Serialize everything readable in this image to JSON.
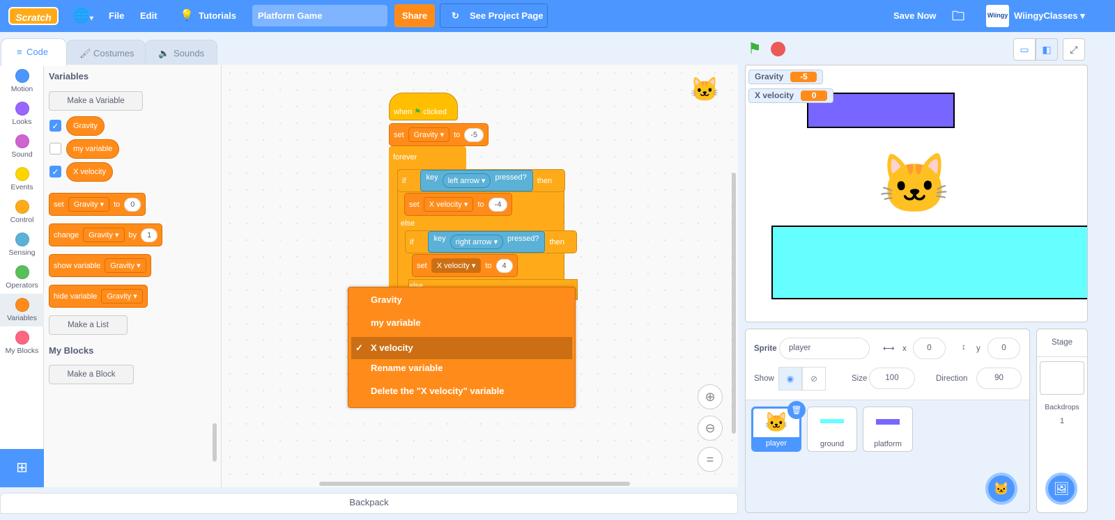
{
  "menubar": {
    "logo": "Scratch",
    "language_icon": "globe-icon",
    "file": "File",
    "edit": "Edit",
    "tutorials": "Tutorials",
    "project_title": "Platform Game",
    "share": "Share",
    "see_project": "See Project Page",
    "save_now": "Save Now",
    "user": "WiingyClasses",
    "user_avatar": "Wiingy"
  },
  "tabs": [
    {
      "label": "Code"
    },
    {
      "label": "Costumes"
    },
    {
      "label": "Sounds"
    }
  ],
  "categories": [
    {
      "label": "Motion",
      "color": "#4c97ff"
    },
    {
      "label": "Looks",
      "color": "#9966ff"
    },
    {
      "label": "Sound",
      "color": "#cf63cf"
    },
    {
      "label": "Events",
      "color": "#ffd500"
    },
    {
      "label": "Control",
      "color": "#ffab19"
    },
    {
      "label": "Sensing",
      "color": "#5cb1d6"
    },
    {
      "label": "Operators",
      "color": "#59c059"
    },
    {
      "label": "Variables",
      "color": "#ff8c1a"
    },
    {
      "label": "My Blocks",
      "color": "#ff6680"
    }
  ],
  "palette": {
    "heading": "Variables",
    "make_variable": "Make a Variable",
    "variables": [
      {
        "name": "Gravity",
        "checked": true
      },
      {
        "name": "my variable",
        "checked": false
      },
      {
        "name": "X velocity",
        "checked": true
      }
    ],
    "set": {
      "t1": "set",
      "var": "Gravity",
      "t2": "to",
      "val": "0"
    },
    "change": {
      "t1": "change",
      "var": "Gravity",
      "t2": "by",
      "val": "1"
    },
    "show": {
      "t1": "show variable",
      "var": "Gravity"
    },
    "hide": {
      "t1": "hide variable",
      "var": "Gravity"
    },
    "make_list": "Make a List",
    "myblocks_heading": "My Blocks",
    "make_block": "Make a Block"
  },
  "script": {
    "hat1": "when",
    "hat2": "clicked",
    "set1": {
      "t1": "set",
      "var": "Gravity",
      "t2": "to",
      "val": "-5"
    },
    "forever": "forever",
    "if1": {
      "if": "if",
      "key": "key",
      "opt": "left arrow",
      "pressed": "pressed?",
      "then": "then"
    },
    "set2": {
      "t1": "set",
      "var": "X velocity",
      "t2": "to",
      "val": "-4"
    },
    "else1": "else",
    "if2": {
      "if": "if",
      "key": "key",
      "opt": "right arrow",
      "pressed": "pressed?",
      "then": "then"
    },
    "set3": {
      "t1": "set",
      "var": "X velocity",
      "t2": "to",
      "val": "4"
    },
    "else2": "else"
  },
  "dropdown": {
    "items": [
      "Gravity",
      "my variable",
      "X velocity",
      "Rename variable",
      "Delete the \"X velocity\" variable"
    ],
    "selected": "X velocity",
    "check": "✓"
  },
  "backpack": "Backpack",
  "stage": {
    "monitors": [
      {
        "label": "Gravity",
        "value": "-5"
      },
      {
        "label": "X velocity",
        "value": "0"
      }
    ],
    "platform_color": "#7766ff",
    "ground_color": "#66ffff"
  },
  "sprite_info": {
    "sprite_label": "Sprite",
    "sprite_name": "player",
    "x_label": "x",
    "x": "0",
    "y_label": "y",
    "y": "0",
    "show_label": "Show",
    "size_label": "Size",
    "size": "100",
    "direction_label": "Direction",
    "direction": "90"
  },
  "sprites": [
    {
      "name": "player",
      "selected": true
    },
    {
      "name": "ground"
    },
    {
      "name": "platform"
    }
  ],
  "stage_selector": {
    "title": "Stage",
    "backdrops_label": "Backdrops",
    "backdrops": "1"
  }
}
